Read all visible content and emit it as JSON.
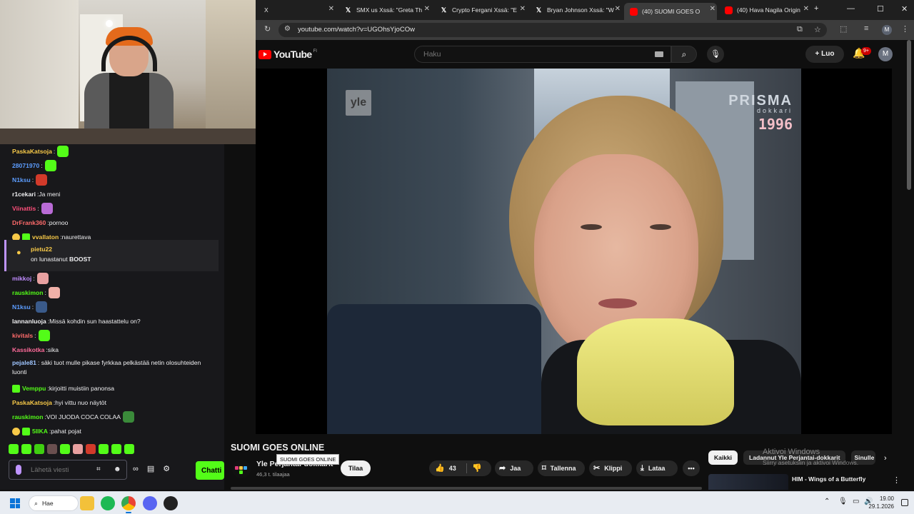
{
  "browser": {
    "tabs": [
      {
        "label": "X",
        "icon": "x-logo-icon"
      },
      {
        "label": "SMX us Xssä: \"Greta Th",
        "icon": "x-logo-icon"
      },
      {
        "label": "Crypto Fergani Xssä: \"E",
        "icon": "x-logo-icon"
      },
      {
        "label": "Bryan Johnson Xssä: \"W",
        "icon": "x-logo-icon"
      },
      {
        "label": "(40) SUOMI GOES O",
        "icon": "youtube-icon",
        "active": true
      },
      {
        "label": "(40) Hava Nagila Origin",
        "icon": "youtube-icon"
      }
    ],
    "url": "youtube.com/watch?v=UGOhsYjoCOw",
    "profile_initial": "M"
  },
  "youtube": {
    "logo_text": "YouTube",
    "country_code": "FI",
    "search_placeholder": "Haku",
    "create_label": "Luo",
    "notification_count": "9+",
    "avatar_initial": "M",
    "video_overlay": {
      "channel_bug": "yle",
      "show_logo": "PRISMA",
      "show_sub": "dokkari",
      "year": "1996"
    },
    "video_title": "SUOMI GOES ONLINE",
    "tooltip": "SUOMI GOES ONLINE",
    "channel_name": "Yle Perjantai-dokkarit",
    "subscribers": "46,3 t. tilaajaa",
    "subscribe_label": "Tilaa",
    "like_count": "43",
    "share_label": "Jaa",
    "save_label": "Tallenna",
    "clip_label": "Klippi",
    "download_label": "Lataa",
    "chips": [
      "Kaikki",
      "Ladannut Yle Perjantai-dokkarit",
      "Sinulle"
    ],
    "recommendation_title": "HIM - Wings of a Butterfly",
    "watermark_line1": "Aktivoi Windows",
    "watermark_line2": "Siirry asetuksiin ja aktivoi Windows."
  },
  "chat": {
    "messages": [
      {
        "user": "PaskaKatsoja",
        "color": "#f7c948",
        "text": "",
        "emote": "#53fc18"
      },
      {
        "user": "28071970",
        "color": "#5c9dff",
        "text": "",
        "emote": "#53fc18"
      },
      {
        "user": "N1ksu",
        "color": "#5c9dff",
        "text": "",
        "emote": "#d23a2a"
      },
      {
        "user": "r1cekari",
        "color": "#efeff1",
        "text": "Ja meni"
      },
      {
        "user": "Viinattis",
        "color": "#ff4f7b",
        "text": "",
        "emote": "#b96bd6"
      },
      {
        "user": "DrFrank360",
        "color": "#ff6b6b",
        "text": "pornoo"
      },
      {
        "user": "vvallaton",
        "color": "#f7c948",
        "text": "naurettava",
        "badges": [
          "#f7c948",
          "#53fc18"
        ]
      }
    ],
    "boost": {
      "user": "pietu22",
      "text": "on lunastanut BOOST"
    },
    "messages2": [
      {
        "user": "mikkoj",
        "color": "#c08cff",
        "text": "",
        "emote": "#e8a0a0"
      },
      {
        "user": "rauskimon",
        "color": "#53fc18",
        "text": "",
        "emote": "#f0b0a8"
      },
      {
        "user": "N1ksu",
        "color": "#5c9dff",
        "text": "",
        "emote": "#3a5a8a"
      },
      {
        "user": "lannanluoja",
        "color": "#efeff1",
        "text": "Missä kohdin sun haastattelu on?"
      },
      {
        "user": "kivitals",
        "color": "#ff6b6b",
        "text": "",
        "emote": "#53fc18"
      },
      {
        "user": "Kassikotka",
        "color": "#ff6b9a",
        "text": "sika"
      }
    ],
    "long_message": {
      "user": "pejale81",
      "color": "#9fc5ff",
      "text": "säki tuot mulle pikase fyrkkaa pelkästää netin olosuhteiden luonti"
    },
    "messages3": [
      {
        "user": "Vemppu",
        "color": "#53fc18",
        "text": "kirjoitti muistiin panonsa",
        "badges": [
          "#53fc18"
        ]
      },
      {
        "user": "PaskaKatsoja",
        "color": "#f7c948",
        "text": "hyi vittu nuo näytöt"
      },
      {
        "user": "rauskimon",
        "color": "#53fc18",
        "text": "VOI JUODA COCA COLAA",
        "emote": "#3a8a3a"
      },
      {
        "user": "5IIKA",
        "color": "#53fc18",
        "text": "pahat pojat",
        "badges": [
          "#f7c948",
          "#53fc18"
        ]
      }
    ],
    "input_placeholder": "Lähetä viesti",
    "send_label": "Chatti"
  },
  "taskbar": {
    "search_label": "Hae",
    "time": "19.00",
    "date": "29.1.2026"
  }
}
